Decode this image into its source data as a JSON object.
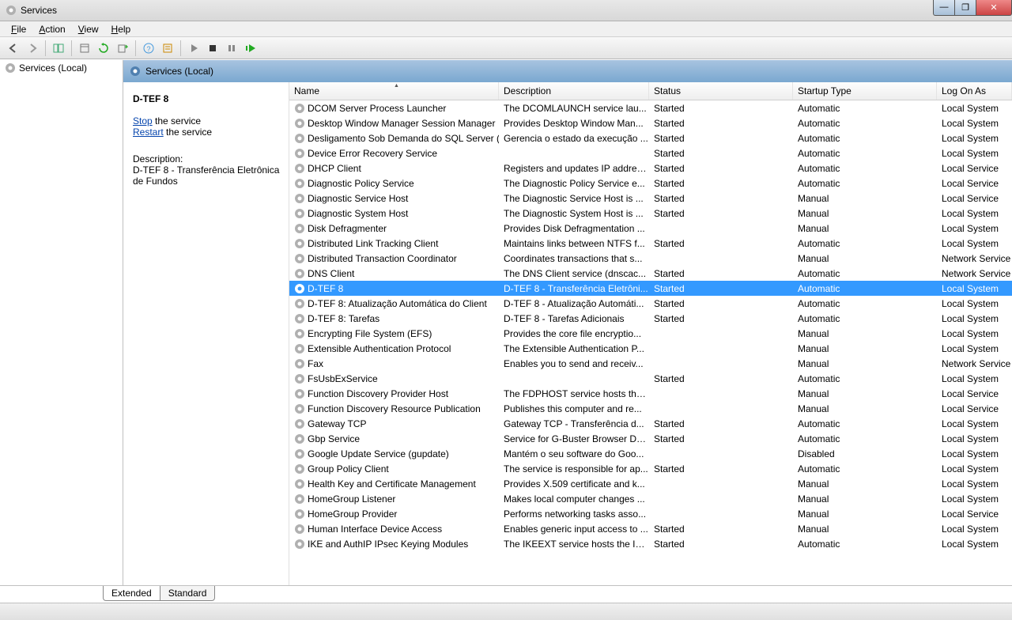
{
  "window": {
    "title": "Services"
  },
  "menu": {
    "file": "File",
    "action": "Action",
    "view": "View",
    "help": "Help"
  },
  "tree": {
    "root": "Services (Local)"
  },
  "panel": {
    "header": "Services (Local)",
    "selected_name": "D-TEF 8",
    "stop_link": "Stop",
    "stop_suffix": " the service",
    "restart_link": "Restart",
    "restart_suffix": " the service",
    "desc_label": "Description:",
    "desc_text": "D-TEF 8 - Transferência Eletrônica de Fundos"
  },
  "columns": {
    "name": "Name",
    "description": "Description",
    "status": "Status",
    "startup": "Startup Type",
    "logon": "Log On As"
  },
  "tabs": {
    "extended": "Extended",
    "standard": "Standard"
  },
  "selected_index": 12,
  "services": [
    {
      "name": "DCOM Server Process Launcher",
      "desc": "The DCOMLAUNCH service lau...",
      "status": "Started",
      "startup": "Automatic",
      "logon": "Local System"
    },
    {
      "name": "Desktop Window Manager Session Manager",
      "desc": "Provides Desktop Window Man...",
      "status": "Started",
      "startup": "Automatic",
      "logon": "Local System"
    },
    {
      "name": "Desligamento Sob Demanda do SQL Server (...",
      "desc": "Gerencia o estado da execução ...",
      "status": "Started",
      "startup": "Automatic",
      "logon": "Local System"
    },
    {
      "name": "Device Error Recovery Service",
      "desc": "",
      "status": "Started",
      "startup": "Automatic",
      "logon": "Local System"
    },
    {
      "name": "DHCP Client",
      "desc": "Registers and updates IP addres...",
      "status": "Started",
      "startup": "Automatic",
      "logon": "Local Service"
    },
    {
      "name": "Diagnostic Policy Service",
      "desc": "The Diagnostic Policy Service e...",
      "status": "Started",
      "startup": "Automatic",
      "logon": "Local Service"
    },
    {
      "name": "Diagnostic Service Host",
      "desc": "The Diagnostic Service Host is ...",
      "status": "Started",
      "startup": "Manual",
      "logon": "Local Service"
    },
    {
      "name": "Diagnostic System Host",
      "desc": "The Diagnostic System Host is ...",
      "status": "Started",
      "startup": "Manual",
      "logon": "Local System"
    },
    {
      "name": "Disk Defragmenter",
      "desc": "Provides Disk Defragmentation ...",
      "status": "",
      "startup": "Manual",
      "logon": "Local System"
    },
    {
      "name": "Distributed Link Tracking Client",
      "desc": "Maintains links between NTFS f...",
      "status": "Started",
      "startup": "Automatic",
      "logon": "Local System"
    },
    {
      "name": "Distributed Transaction Coordinator",
      "desc": "Coordinates transactions that s...",
      "status": "",
      "startup": "Manual",
      "logon": "Network Service"
    },
    {
      "name": "DNS Client",
      "desc": "The DNS Client service (dnscac...",
      "status": "Started",
      "startup": "Automatic",
      "logon": "Network Service"
    },
    {
      "name": "D-TEF 8",
      "desc": "D-TEF 8 - Transferência Eletrôni...",
      "status": "Started",
      "startup": "Automatic",
      "logon": "Local System"
    },
    {
      "name": "D-TEF 8: Atualização Automática do Client",
      "desc": "D-TEF 8 - Atualização Automáti...",
      "status": "Started",
      "startup": "Automatic",
      "logon": "Local System"
    },
    {
      "name": "D-TEF 8: Tarefas",
      "desc": "D-TEF 8 - Tarefas Adicionais",
      "status": "Started",
      "startup": "Automatic",
      "logon": "Local System"
    },
    {
      "name": "Encrypting File System (EFS)",
      "desc": "Provides the core file encryptio...",
      "status": "",
      "startup": "Manual",
      "logon": "Local System"
    },
    {
      "name": "Extensible Authentication Protocol",
      "desc": "The Extensible Authentication P...",
      "status": "",
      "startup": "Manual",
      "logon": "Local System"
    },
    {
      "name": "Fax",
      "desc": "Enables you to send and receiv...",
      "status": "",
      "startup": "Manual",
      "logon": "Network Service"
    },
    {
      "name": "FsUsbExService",
      "desc": "",
      "status": "Started",
      "startup": "Automatic",
      "logon": "Local System"
    },
    {
      "name": "Function Discovery Provider Host",
      "desc": "The FDPHOST service hosts the...",
      "status": "",
      "startup": "Manual",
      "logon": "Local Service"
    },
    {
      "name": "Function Discovery Resource Publication",
      "desc": "Publishes this computer and re...",
      "status": "",
      "startup": "Manual",
      "logon": "Local Service"
    },
    {
      "name": "Gateway TCP",
      "desc": "Gateway TCP - Transferência d...",
      "status": "Started",
      "startup": "Automatic",
      "logon": "Local System"
    },
    {
      "name": "Gbp Service",
      "desc": "Service for G-Buster Browser De...",
      "status": "Started",
      "startup": "Automatic",
      "logon": "Local System"
    },
    {
      "name": "Google Update Service (gupdate)",
      "desc": "Mantém o seu software do Goo...",
      "status": "",
      "startup": "Disabled",
      "logon": "Local System"
    },
    {
      "name": "Group Policy Client",
      "desc": "The service is responsible for ap...",
      "status": "Started",
      "startup": "Automatic",
      "logon": "Local System"
    },
    {
      "name": "Health Key and Certificate Management",
      "desc": "Provides X.509 certificate and k...",
      "status": "",
      "startup": "Manual",
      "logon": "Local System"
    },
    {
      "name": "HomeGroup Listener",
      "desc": "Makes local computer changes ...",
      "status": "",
      "startup": "Manual",
      "logon": "Local System"
    },
    {
      "name": "HomeGroup Provider",
      "desc": "Performs networking tasks asso...",
      "status": "",
      "startup": "Manual",
      "logon": "Local Service"
    },
    {
      "name": "Human Interface Device Access",
      "desc": "Enables generic input access to ...",
      "status": "Started",
      "startup": "Manual",
      "logon": "Local System"
    },
    {
      "name": "IKE and AuthIP IPsec Keying Modules",
      "desc": "The IKEEXT service hosts the Int...",
      "status": "Started",
      "startup": "Automatic",
      "logon": "Local System"
    }
  ]
}
